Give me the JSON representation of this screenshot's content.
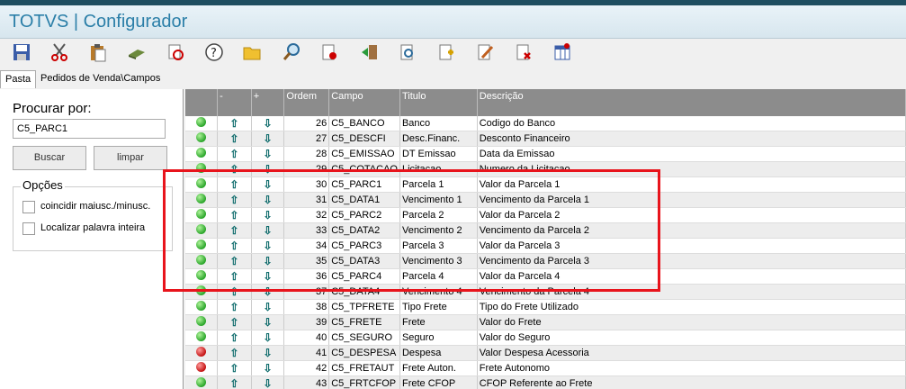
{
  "app": {
    "title": "TOTVS | Configurador"
  },
  "toolbar": [
    {
      "icon": "cut-icon"
    },
    {
      "icon": "paste-icon"
    },
    {
      "icon": "book-icon"
    },
    {
      "icon": "refresh-icon"
    },
    {
      "icon": "help-icon"
    },
    {
      "icon": "folder-icon"
    },
    {
      "icon": "search-icon"
    },
    {
      "icon": "file-exit-icon"
    },
    {
      "icon": "exit-icon"
    },
    {
      "icon": "preview-icon"
    },
    {
      "icon": "add-icon"
    },
    {
      "icon": "edit-icon"
    },
    {
      "icon": "delete-icon"
    },
    {
      "icon": "table-icon"
    }
  ],
  "tabs": {
    "pasta": "Pasta",
    "pedidos": "Pedidos de Venda\\Campos"
  },
  "search": {
    "label": "Procurar por:",
    "value": "C5_PARC1",
    "buscar": "Buscar",
    "limpar": "limpar"
  },
  "opcoes": {
    "title": "Opções",
    "opt1": "coincidir maiusc./minusc.",
    "opt2": "Localizar palavra inteira"
  },
  "grid": {
    "headers": [
      "",
      "-",
      "+",
      "Ordem",
      "Campo",
      "Titulo",
      "Descrição"
    ],
    "rows": [
      {
        "status": "green",
        "ordem": "26",
        "campo": "C5_BANCO",
        "titulo": "Banco",
        "descricao": "Codigo do Banco"
      },
      {
        "status": "green",
        "ordem": "27",
        "campo": "C5_DESCFI",
        "titulo": "Desc.Financ.",
        "descricao": "Desconto Financeiro"
      },
      {
        "status": "green",
        "ordem": "28",
        "campo": "C5_EMISSAO",
        "titulo": "DT Emissao",
        "descricao": "Data da Emissao"
      },
      {
        "status": "green",
        "ordem": "29",
        "campo": "C5_COTACAO",
        "titulo": "Licitacao",
        "descricao": "Numero da Licitacao"
      },
      {
        "status": "green",
        "ordem": "30",
        "campo": "C5_PARC1",
        "titulo": "Parcela 1",
        "descricao": "Valor da Parcela 1"
      },
      {
        "status": "green",
        "ordem": "31",
        "campo": "C5_DATA1",
        "titulo": "Vencimento 1",
        "descricao": "Vencimento da Parcela 1"
      },
      {
        "status": "green",
        "ordem": "32",
        "campo": "C5_PARC2",
        "titulo": "Parcela 2",
        "descricao": "Valor da Parcela 2"
      },
      {
        "status": "green",
        "ordem": "33",
        "campo": "C5_DATA2",
        "titulo": "Vencimento 2",
        "descricao": "Vencimento da Parcela 2"
      },
      {
        "status": "green",
        "ordem": "34",
        "campo": "C5_PARC3",
        "titulo": "Parcela 3",
        "descricao": "Valor da Parcela 3"
      },
      {
        "status": "green",
        "ordem": "35",
        "campo": "C5_DATA3",
        "titulo": "Vencimento 3",
        "descricao": "Vencimento da Parcela 3"
      },
      {
        "status": "green",
        "ordem": "36",
        "campo": "C5_PARC4",
        "titulo": "Parcela 4",
        "descricao": "Valor da Parcela 4"
      },
      {
        "status": "green",
        "ordem": "37",
        "campo": "C5_DATA4",
        "titulo": "Vencimento 4",
        "descricao": "Vencimento da Parcela 4"
      },
      {
        "status": "green",
        "ordem": "38",
        "campo": "C5_TPFRETE",
        "titulo": "Tipo Frete",
        "descricao": "Tipo do Frete Utilizado"
      },
      {
        "status": "green",
        "ordem": "39",
        "campo": "C5_FRETE",
        "titulo": "Frete",
        "descricao": "Valor do Frete"
      },
      {
        "status": "green",
        "ordem": "40",
        "campo": "C5_SEGURO",
        "titulo": "Seguro",
        "descricao": "Valor do Seguro"
      },
      {
        "status": "red",
        "ordem": "41",
        "campo": "C5_DESPESA",
        "titulo": "Despesa",
        "descricao": "Valor Despesa Acessoria"
      },
      {
        "status": "red",
        "ordem": "42",
        "campo": "C5_FRETAUT",
        "titulo": "Frete Auton.",
        "descricao": "Frete Autonomo"
      },
      {
        "status": "green",
        "ordem": "43",
        "campo": "C5_FRTCFOP",
        "titulo": "Frete CFOP",
        "descricao": "CFOP Referente ao Frete"
      }
    ]
  },
  "colors": {
    "accent": "#2b7fa8",
    "highlight": "#e8141c",
    "header": "#8c8c8c"
  }
}
